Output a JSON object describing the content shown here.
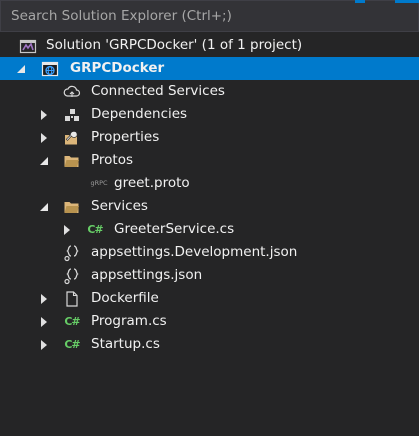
{
  "search": {
    "placeholder": "Search Solution Explorer (Ctrl+;)"
  },
  "solution": {
    "label": "Solution 'GRPCDocker' (1 of 1 project)"
  },
  "project": {
    "label": "GRPCDocker"
  },
  "items": [
    {
      "label": "Connected Services",
      "icon": "connected-services-icon"
    },
    {
      "label": "Dependencies",
      "icon": "dependencies-icon"
    },
    {
      "label": "Properties",
      "icon": "properties-icon"
    },
    {
      "label": "Protos",
      "icon": "folder-icon"
    },
    {
      "label": "greet.proto",
      "icon": "grpc-file-icon",
      "icon_text": "gRPC"
    },
    {
      "label": "Services",
      "icon": "folder-icon"
    },
    {
      "label": "GreeterService.cs",
      "icon": "csharp-file-icon",
      "icon_text": "C#"
    },
    {
      "label": "appsettings.Development.json",
      "icon": "json-file-icon"
    },
    {
      "label": "appsettings.json",
      "icon": "json-file-icon"
    },
    {
      "label": "Dockerfile",
      "icon": "file-icon"
    },
    {
      "label": "Program.cs",
      "icon": "csharp-file-icon",
      "icon_text": "C#"
    },
    {
      "label": "Startup.cs",
      "icon": "csharp-file-icon",
      "icon_text": "C#"
    }
  ],
  "colors": {
    "background": "#252526",
    "selection": "#007acc",
    "text": "#f1f1f1",
    "csharp": "#66cc66",
    "folder": "#dcb67a"
  }
}
